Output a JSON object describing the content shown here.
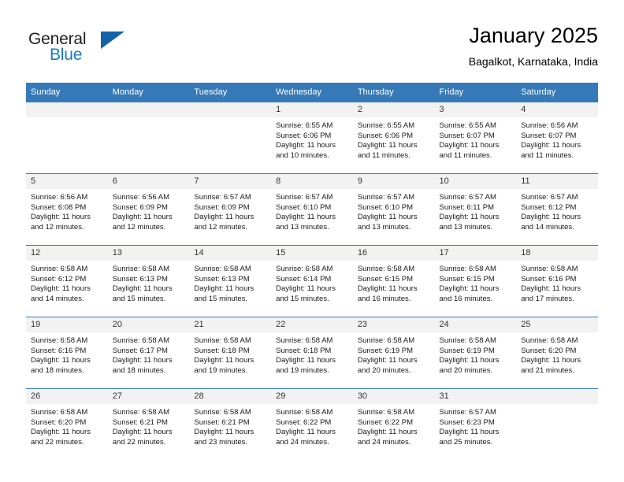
{
  "brand": {
    "name_part1": "General",
    "name_part2": "Blue",
    "logo_icon": "triangle-logo-icon",
    "accent_color": "#1263a8",
    "text_color": "#1a7ac4"
  },
  "header": {
    "title": "January 2025",
    "subtitle": "Bagalkot, Karnataka, India"
  },
  "theme": {
    "header_bg": "#3679b9",
    "header_text": "#ffffff",
    "daynum_bg": "#f2f2f2",
    "cell_bg": "#ffffff",
    "grid_line": "#3679b9"
  },
  "weekdays": [
    "Sunday",
    "Monday",
    "Tuesday",
    "Wednesday",
    "Thursday",
    "Friday",
    "Saturday"
  ],
  "weeks": [
    [
      {
        "day": "",
        "sunrise": "",
        "sunset": "",
        "daylight_line1": "",
        "daylight_line2": "",
        "empty": true
      },
      {
        "day": "",
        "sunrise": "",
        "sunset": "",
        "daylight_line1": "",
        "daylight_line2": "",
        "empty": true
      },
      {
        "day": "",
        "sunrise": "",
        "sunset": "",
        "daylight_line1": "",
        "daylight_line2": "",
        "empty": true
      },
      {
        "day": "1",
        "sunrise": "Sunrise: 6:55 AM",
        "sunset": "Sunset: 6:06 PM",
        "daylight_line1": "Daylight: 11 hours",
        "daylight_line2": "and 10 minutes.",
        "empty": false
      },
      {
        "day": "2",
        "sunrise": "Sunrise: 6:55 AM",
        "sunset": "Sunset: 6:06 PM",
        "daylight_line1": "Daylight: 11 hours",
        "daylight_line2": "and 11 minutes.",
        "empty": false
      },
      {
        "day": "3",
        "sunrise": "Sunrise: 6:55 AM",
        "sunset": "Sunset: 6:07 PM",
        "daylight_line1": "Daylight: 11 hours",
        "daylight_line2": "and 11 minutes.",
        "empty": false
      },
      {
        "day": "4",
        "sunrise": "Sunrise: 6:56 AM",
        "sunset": "Sunset: 6:07 PM",
        "daylight_line1": "Daylight: 11 hours",
        "daylight_line2": "and 11 minutes.",
        "empty": false
      }
    ],
    [
      {
        "day": "5",
        "sunrise": "Sunrise: 6:56 AM",
        "sunset": "Sunset: 6:08 PM",
        "daylight_line1": "Daylight: 11 hours",
        "daylight_line2": "and 12 minutes.",
        "empty": false
      },
      {
        "day": "6",
        "sunrise": "Sunrise: 6:56 AM",
        "sunset": "Sunset: 6:09 PM",
        "daylight_line1": "Daylight: 11 hours",
        "daylight_line2": "and 12 minutes.",
        "empty": false
      },
      {
        "day": "7",
        "sunrise": "Sunrise: 6:57 AM",
        "sunset": "Sunset: 6:09 PM",
        "daylight_line1": "Daylight: 11 hours",
        "daylight_line2": "and 12 minutes.",
        "empty": false
      },
      {
        "day": "8",
        "sunrise": "Sunrise: 6:57 AM",
        "sunset": "Sunset: 6:10 PM",
        "daylight_line1": "Daylight: 11 hours",
        "daylight_line2": "and 13 minutes.",
        "empty": false
      },
      {
        "day": "9",
        "sunrise": "Sunrise: 6:57 AM",
        "sunset": "Sunset: 6:10 PM",
        "daylight_line1": "Daylight: 11 hours",
        "daylight_line2": "and 13 minutes.",
        "empty": false
      },
      {
        "day": "10",
        "sunrise": "Sunrise: 6:57 AM",
        "sunset": "Sunset: 6:11 PM",
        "daylight_line1": "Daylight: 11 hours",
        "daylight_line2": "and 13 minutes.",
        "empty": false
      },
      {
        "day": "11",
        "sunrise": "Sunrise: 6:57 AM",
        "sunset": "Sunset: 6:12 PM",
        "daylight_line1": "Daylight: 11 hours",
        "daylight_line2": "and 14 minutes.",
        "empty": false
      }
    ],
    [
      {
        "day": "12",
        "sunrise": "Sunrise: 6:58 AM",
        "sunset": "Sunset: 6:12 PM",
        "daylight_line1": "Daylight: 11 hours",
        "daylight_line2": "and 14 minutes.",
        "empty": false
      },
      {
        "day": "13",
        "sunrise": "Sunrise: 6:58 AM",
        "sunset": "Sunset: 6:13 PM",
        "daylight_line1": "Daylight: 11 hours",
        "daylight_line2": "and 15 minutes.",
        "empty": false
      },
      {
        "day": "14",
        "sunrise": "Sunrise: 6:58 AM",
        "sunset": "Sunset: 6:13 PM",
        "daylight_line1": "Daylight: 11 hours",
        "daylight_line2": "and 15 minutes.",
        "empty": false
      },
      {
        "day": "15",
        "sunrise": "Sunrise: 6:58 AM",
        "sunset": "Sunset: 6:14 PM",
        "daylight_line1": "Daylight: 11 hours",
        "daylight_line2": "and 15 minutes.",
        "empty": false
      },
      {
        "day": "16",
        "sunrise": "Sunrise: 6:58 AM",
        "sunset": "Sunset: 6:15 PM",
        "daylight_line1": "Daylight: 11 hours",
        "daylight_line2": "and 16 minutes.",
        "empty": false
      },
      {
        "day": "17",
        "sunrise": "Sunrise: 6:58 AM",
        "sunset": "Sunset: 6:15 PM",
        "daylight_line1": "Daylight: 11 hours",
        "daylight_line2": "and 16 minutes.",
        "empty": false
      },
      {
        "day": "18",
        "sunrise": "Sunrise: 6:58 AM",
        "sunset": "Sunset: 6:16 PM",
        "daylight_line1": "Daylight: 11 hours",
        "daylight_line2": "and 17 minutes.",
        "empty": false
      }
    ],
    [
      {
        "day": "19",
        "sunrise": "Sunrise: 6:58 AM",
        "sunset": "Sunset: 6:16 PM",
        "daylight_line1": "Daylight: 11 hours",
        "daylight_line2": "and 18 minutes.",
        "empty": false
      },
      {
        "day": "20",
        "sunrise": "Sunrise: 6:58 AM",
        "sunset": "Sunset: 6:17 PM",
        "daylight_line1": "Daylight: 11 hours",
        "daylight_line2": "and 18 minutes.",
        "empty": false
      },
      {
        "day": "21",
        "sunrise": "Sunrise: 6:58 AM",
        "sunset": "Sunset: 6:18 PM",
        "daylight_line1": "Daylight: 11 hours",
        "daylight_line2": "and 19 minutes.",
        "empty": false
      },
      {
        "day": "22",
        "sunrise": "Sunrise: 6:58 AM",
        "sunset": "Sunset: 6:18 PM",
        "daylight_line1": "Daylight: 11 hours",
        "daylight_line2": "and 19 minutes.",
        "empty": false
      },
      {
        "day": "23",
        "sunrise": "Sunrise: 6:58 AM",
        "sunset": "Sunset: 6:19 PM",
        "daylight_line1": "Daylight: 11 hours",
        "daylight_line2": "and 20 minutes.",
        "empty": false
      },
      {
        "day": "24",
        "sunrise": "Sunrise: 6:58 AM",
        "sunset": "Sunset: 6:19 PM",
        "daylight_line1": "Daylight: 11 hours",
        "daylight_line2": "and 20 minutes.",
        "empty": false
      },
      {
        "day": "25",
        "sunrise": "Sunrise: 6:58 AM",
        "sunset": "Sunset: 6:20 PM",
        "daylight_line1": "Daylight: 11 hours",
        "daylight_line2": "and 21 minutes.",
        "empty": false
      }
    ],
    [
      {
        "day": "26",
        "sunrise": "Sunrise: 6:58 AM",
        "sunset": "Sunset: 6:20 PM",
        "daylight_line1": "Daylight: 11 hours",
        "daylight_line2": "and 22 minutes.",
        "empty": false
      },
      {
        "day": "27",
        "sunrise": "Sunrise: 6:58 AM",
        "sunset": "Sunset: 6:21 PM",
        "daylight_line1": "Daylight: 11 hours",
        "daylight_line2": "and 22 minutes.",
        "empty": false
      },
      {
        "day": "28",
        "sunrise": "Sunrise: 6:58 AM",
        "sunset": "Sunset: 6:21 PM",
        "daylight_line1": "Daylight: 11 hours",
        "daylight_line2": "and 23 minutes.",
        "empty": false
      },
      {
        "day": "29",
        "sunrise": "Sunrise: 6:58 AM",
        "sunset": "Sunset: 6:22 PM",
        "daylight_line1": "Daylight: 11 hours",
        "daylight_line2": "and 24 minutes.",
        "empty": false
      },
      {
        "day": "30",
        "sunrise": "Sunrise: 6:58 AM",
        "sunset": "Sunset: 6:22 PM",
        "daylight_line1": "Daylight: 11 hours",
        "daylight_line2": "and 24 minutes.",
        "empty": false
      },
      {
        "day": "31",
        "sunrise": "Sunrise: 6:57 AM",
        "sunset": "Sunset: 6:23 PM",
        "daylight_line1": "Daylight: 11 hours",
        "daylight_line2": "and 25 minutes.",
        "empty": false
      },
      {
        "day": "",
        "sunrise": "",
        "sunset": "",
        "daylight_line1": "",
        "daylight_line2": "",
        "empty": true
      }
    ]
  ]
}
